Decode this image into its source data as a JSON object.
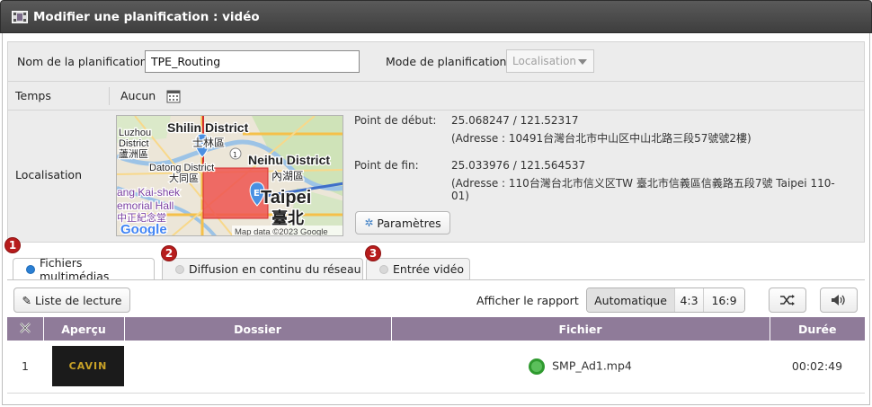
{
  "window": {
    "title": "Modifier une planification : vidéo"
  },
  "form": {
    "name_label": "Nom de la planification",
    "name_value": "TPE_Routing",
    "mode_label": "Mode de planification",
    "mode_value": "Localisation",
    "time_label": "Temps",
    "time_value": "Aucun",
    "location_label": "Localisation"
  },
  "map": {
    "labels": [
      "Shilin District",
      "士林區",
      "Luzhou",
      "District",
      "蘆洲區",
      "Datong District",
      "大同區",
      "Neihu District",
      "內湖區",
      "Taipei",
      "臺北",
      "ang Kai-shek",
      "emorial Hall",
      "中正紀念堂"
    ],
    "start_marker": "S",
    "end_marker": "E",
    "road_badge": "1",
    "google_logo": "Google",
    "attribution": "Map data ©2023 Google"
  },
  "location": {
    "start_label": "Point de début:",
    "start_coords": "25.068247 / 121.52317",
    "start_address": "(Adresse : 10491台灣台北市中山区中山北路三段57號號2樓)",
    "end_label": "Point de fin:",
    "end_coords": "25.033976 / 121.564537",
    "end_address": "(Adresse : 110台灣台北市信义区TW 臺北市信義區信義路五段7號 Taipei 110-01)",
    "params_button": "Paramètres"
  },
  "tabs": [
    {
      "label": "Fichiers multimédias",
      "badge": "1",
      "active": true
    },
    {
      "label": "Diffusion en continu du réseau",
      "badge": "2",
      "active": false
    },
    {
      "label": "Entrée vidéo",
      "badge": "3",
      "active": false
    }
  ],
  "toolbar": {
    "playlist_button": "Liste de lecture",
    "ratio_label": "Afficher le rapport",
    "ratio_options": [
      "Automatique",
      "4:3",
      "16:9"
    ],
    "ratio_selected": "Automatique"
  },
  "table": {
    "columns": [
      "Aperçu",
      "Dossier",
      "Fichier",
      "Durée"
    ],
    "rows": [
      {
        "index": "1",
        "thumb_text": "CAVIN",
        "folder": "",
        "file": "SMP_Ad1.mp4",
        "duration": "00:02:49"
      }
    ]
  },
  "colors": {
    "header_bg": "#8f7b99",
    "titlebar": "#4a4a4a",
    "active_radio": "#2a7fd3",
    "status_ok": "#5bbf5b",
    "badge": "#b71c1c"
  }
}
